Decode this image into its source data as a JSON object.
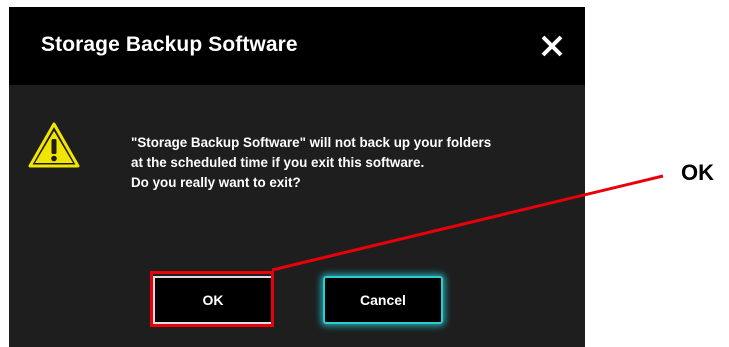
{
  "dialog": {
    "title": "Storage Backup Software",
    "close_icon": "close-icon",
    "warning_icon": "warning-triangle-icon",
    "message_lines": [
      "\"Storage Backup Software\" will not back up your folders",
      "at the scheduled time if you exit this software.",
      "Do you really want to exit?"
    ],
    "ok_label": "OK",
    "cancel_label": "Cancel"
  },
  "annotation": {
    "label": "OK",
    "color": "#e8000b"
  },
  "colors": {
    "titlebar": "#000000",
    "body": "#1e1e1e",
    "cancel_accent": "#2ecbd1",
    "warning": "#f2e600"
  }
}
